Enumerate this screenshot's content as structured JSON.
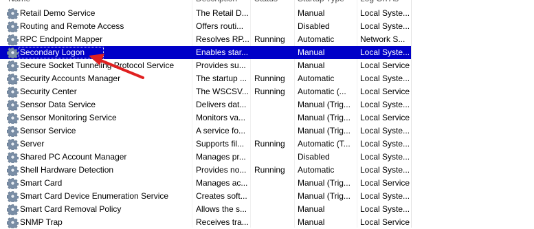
{
  "columns": {
    "name": "Name",
    "description": "Description",
    "status": "Status",
    "startup_type": "Startup Type",
    "log_on_as": "Log On As"
  },
  "services": [
    {
      "name": "Retail Demo Service",
      "description": "The Retail D...",
      "status": "",
      "startup": "Manual",
      "logon": "Local Syste..."
    },
    {
      "name": "Routing and Remote Access",
      "description": "Offers routi...",
      "status": "",
      "startup": "Disabled",
      "logon": "Local Syste..."
    },
    {
      "name": "RPC Endpoint Mapper",
      "description": "Resolves RP...",
      "status": "Running",
      "startup": "Automatic",
      "logon": "Network S..."
    },
    {
      "name": "Secondary Logon",
      "description": "Enables star...",
      "status": "",
      "startup": "Manual",
      "logon": "Local Syste...",
      "selected": true
    },
    {
      "name": "Secure Socket Tunneling Protocol Service",
      "description": "Provides su...",
      "status": "",
      "startup": "Manual",
      "logon": "Local Service"
    },
    {
      "name": "Security Accounts Manager",
      "description": "The startup ...",
      "status": "Running",
      "startup": "Automatic",
      "logon": "Local Syste..."
    },
    {
      "name": "Security Center",
      "description": "The WSCSV...",
      "status": "Running",
      "startup": "Automatic (...",
      "logon": "Local Service"
    },
    {
      "name": "Sensor Data Service",
      "description": "Delivers dat...",
      "status": "",
      "startup": "Manual (Trig...",
      "logon": "Local Syste..."
    },
    {
      "name": "Sensor Monitoring Service",
      "description": "Monitors va...",
      "status": "",
      "startup": "Manual (Trig...",
      "logon": "Local Service"
    },
    {
      "name": "Sensor Service",
      "description": "A service fo...",
      "status": "",
      "startup": "Manual (Trig...",
      "logon": "Local Syste..."
    },
    {
      "name": "Server",
      "description": "Supports fil...",
      "status": "Running",
      "startup": "Automatic (T...",
      "logon": "Local Syste..."
    },
    {
      "name": "Shared PC Account Manager",
      "description": "Manages pr...",
      "status": "",
      "startup": "Disabled",
      "logon": "Local Syste..."
    },
    {
      "name": "Shell Hardware Detection",
      "description": "Provides no...",
      "status": "Running",
      "startup": "Automatic",
      "logon": "Local Syste..."
    },
    {
      "name": "Smart Card",
      "description": "Manages ac...",
      "status": "",
      "startup": "Manual (Trig...",
      "logon": "Local Service"
    },
    {
      "name": "Smart Card Device Enumeration Service",
      "description": "Creates soft...",
      "status": "",
      "startup": "Manual (Trig...",
      "logon": "Local Syste..."
    },
    {
      "name": "Smart Card Removal Policy",
      "description": "Allows the s...",
      "status": "",
      "startup": "Manual",
      "logon": "Local Syste..."
    },
    {
      "name": "SNMP Trap",
      "description": "Receives tra...",
      "status": "",
      "startup": "Manual",
      "logon": "Local Service"
    }
  ],
  "colors": {
    "selection": "#0000c8",
    "annotation_arrow": "#e02020"
  },
  "icons": {
    "service": "gear-icon",
    "annotation": "arrow-icon"
  }
}
